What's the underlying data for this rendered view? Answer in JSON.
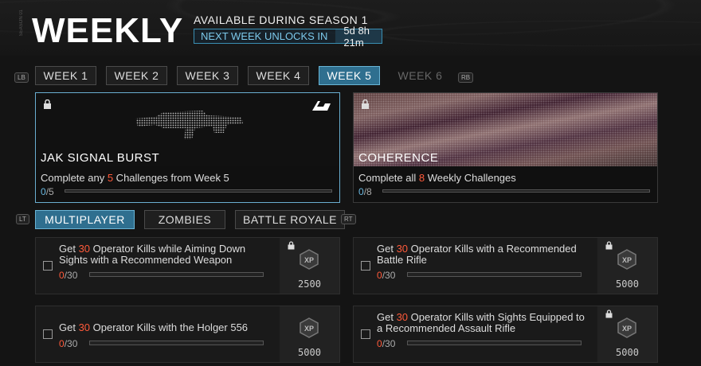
{
  "header": {
    "title": "WEEKLY",
    "season_tag": "SEASON 01",
    "available": "AVAILABLE DURING SEASON 1",
    "unlock_label": "NEXT WEEK UNLOCKS IN",
    "unlock_time": "5d 8h 21m"
  },
  "bumpers": {
    "lb": "LB",
    "rb": "RB",
    "lt": "LT",
    "rt": "RT"
  },
  "weeks": [
    {
      "label": "WEEK 1"
    },
    {
      "label": "WEEK 2"
    },
    {
      "label": "WEEK 3"
    },
    {
      "label": "WEEK 4"
    },
    {
      "label": "WEEK 5",
      "active": true
    },
    {
      "label": "WEEK 6",
      "locked": true
    }
  ],
  "rewards": [
    {
      "name": "JAK SIGNAL BURST",
      "desc_pre": "Complete any ",
      "desc_num": "5",
      "desc_post": " Challenges from Week 5",
      "progress_current": "0",
      "progress_total": "/5"
    },
    {
      "name": "COHERENCE",
      "desc_pre": "Complete all ",
      "desc_num": "8",
      "desc_post": " Weekly Challenges",
      "progress_current": "0",
      "progress_total": "/8"
    }
  ],
  "modes": [
    {
      "label": "MULTIPLAYER",
      "active": true
    },
    {
      "label": "ZOMBIES"
    },
    {
      "label": "BATTLE ROYALE"
    }
  ],
  "challenges": [
    {
      "pre": "Get ",
      "num": "30",
      "line1": " Operator Kills while Aiming Down",
      "line2": "Sights with a Recommended Weapon",
      "cur": "0",
      "tot": "/30",
      "xp": "2500"
    },
    {
      "pre": "Get ",
      "num": "30",
      "line1": " Operator Kills with a Recommended",
      "line2": "Battle Rifle",
      "cur": "0",
      "tot": "/30",
      "xp": "5000"
    },
    {
      "pre": "Get ",
      "num": "30",
      "line1": " Operator Kills with the Holger 556",
      "line2": "",
      "cur": "0",
      "tot": "/30",
      "xp": "5000"
    },
    {
      "pre": "Get ",
      "num": "30",
      "line1": " Operator Kills with Sights Equipped to",
      "line2": "a Recommended Assault Rifle",
      "cur": "0",
      "tot": "/30",
      "xp": "5000"
    }
  ],
  "xp_icon_text": "XP",
  "colors": {
    "accent": "#2f6f8f",
    "highlight": "#ff5a3a",
    "progress": "#6ab8e0"
  }
}
